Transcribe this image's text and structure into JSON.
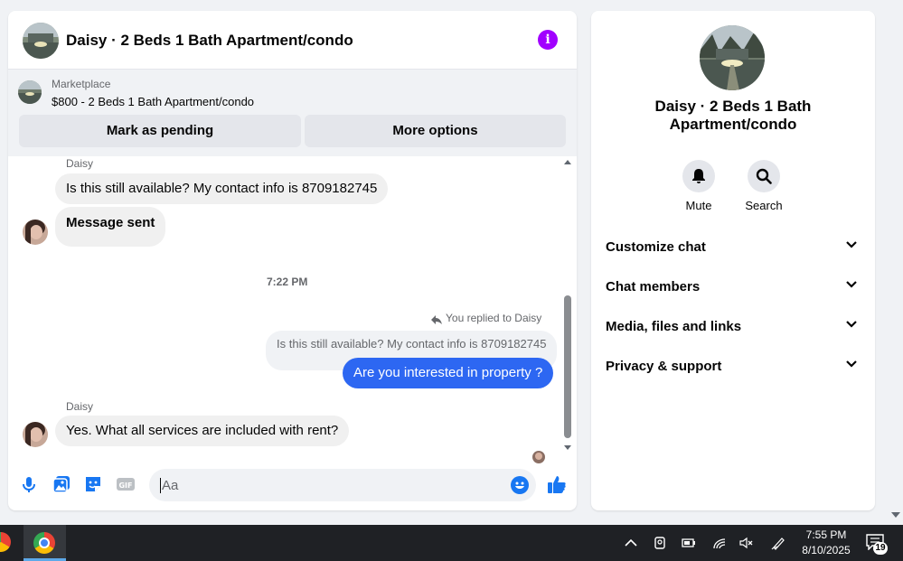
{
  "chat": {
    "title": "Daisy · 2 Beds 1 Bath Apartment/condo",
    "marketplace_label": "Marketplace",
    "listing_title": "$800 - 2 Beds 1 Bath Apartment/condo",
    "mark_pending_label": "Mark as pending",
    "more_options_label": "More options",
    "messages": {
      "sender_1": "Daisy",
      "msg_1": "Is this still available? My contact info is 8709182745",
      "msg_2": "Message sent",
      "timestamp": "7:22 PM",
      "replied_label": "You replied to Daisy",
      "quoted": "Is this still available? My contact info is 8709182745",
      "reply": "Are you interested in property ?",
      "sender_2": "Daisy",
      "msg_3": "Yes. What all services are included with rent?"
    },
    "composer_placeholder": "Aa"
  },
  "info": {
    "name": "Daisy · 2 Beds 1 Bath Apartment/condo",
    "mute_label": "Mute",
    "search_label": "Search",
    "sections": [
      "Customize chat",
      "Chat members",
      "Media, files and links",
      "Privacy & support"
    ]
  },
  "taskbar": {
    "time": "7:55 PM",
    "date": "8/10/2025",
    "notification_count": "19"
  },
  "colors": {
    "accent": "#2d67f2",
    "info_icon": "#a100ff",
    "like": "#1877f2"
  }
}
